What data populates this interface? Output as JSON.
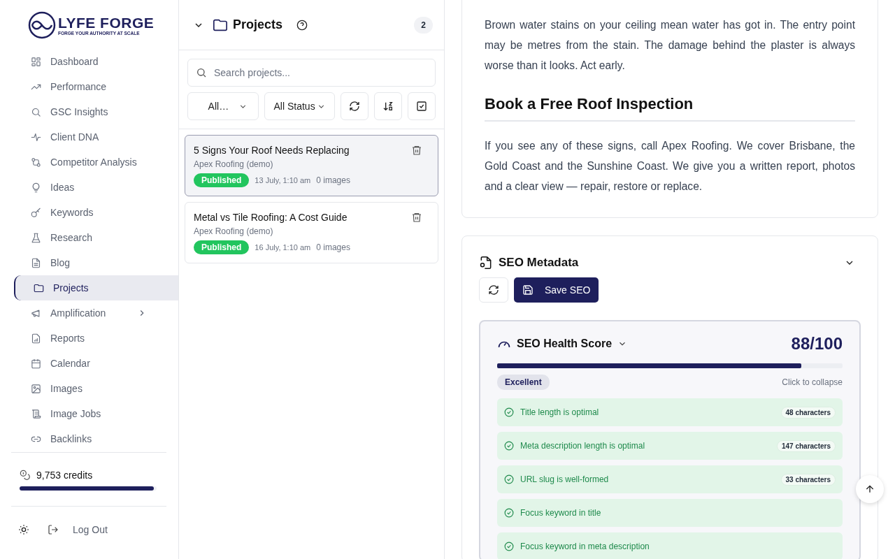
{
  "brand": {
    "name": "LYFE FORGE",
    "tagline": "FORGE YOUR AUTHORITY AT SCALE"
  },
  "sidebar": {
    "items": [
      {
        "label": "Dashboard",
        "selected": false
      },
      {
        "label": "Performance",
        "selected": false
      },
      {
        "label": "GSC Insights",
        "selected": false
      },
      {
        "label": "Client DNA",
        "selected": false
      },
      {
        "label": "Competitor Analysis",
        "selected": false
      },
      {
        "label": "Ideas",
        "selected": false
      },
      {
        "label": "Keywords",
        "selected": false
      },
      {
        "label": "Research",
        "selected": false
      },
      {
        "label": "Blog",
        "selected": false
      },
      {
        "label": "Projects",
        "selected": true
      },
      {
        "label": "Amplification",
        "selected": false,
        "expandable": true
      },
      {
        "label": "Reports",
        "selected": false
      },
      {
        "label": "Calendar",
        "selected": false
      },
      {
        "label": "Images",
        "selected": false
      },
      {
        "label": "Image Jobs",
        "selected": false
      },
      {
        "label": "Backlinks",
        "selected": false
      }
    ],
    "credits": {
      "text": "9,753 credits",
      "level": 0.98
    },
    "logout": "Log Out"
  },
  "projects": {
    "title": "Projects",
    "count": "2",
    "search": {
      "placeholder": "Search projects..."
    },
    "filters": [
      "All…",
      "All Status"
    ],
    "items": [
      {
        "title": "5 Signs Your Roof Needs Replacing",
        "client": "Apex Roofing (demo)",
        "status": "Published",
        "date": "13 July, 1:10 am",
        "images": "0 images",
        "selected": true
      },
      {
        "title": "Metal vs Tile Roofing: A Cost Guide",
        "client": "Apex Roofing (demo)",
        "status": "Published",
        "date": "16 July, 1:10 am",
        "images": "0 images",
        "selected": false
      }
    ]
  },
  "article": {
    "blocks": [
      {
        "kind": "paragraph",
        "text": "Brown water stains on your ceiling mean water has got in. The entry point may be metres from the stain. The damage behind the plaster is always worse than it looks. Act early."
      },
      {
        "kind": "heading",
        "text": "Book a Free Roof Inspection"
      },
      {
        "kind": "paragraph",
        "text": "If you see any of these signs, call Apex Roofing. We cover Brisbane, the Gold Coast and the Sunshine Coast. We give you a written report, photos and a clear view — repair, restore or replace."
      }
    ]
  },
  "seo": {
    "title": "SEO Metadata",
    "save": "Save SEO",
    "health": {
      "title": "SEO Health Score",
      "score": "88/100",
      "level": 0.88,
      "rating": "Excellent",
      "hint": "Click to collapse",
      "checks": [
        {
          "text": "Title length is optimal",
          "detail": "48 characters",
          "passed": true
        },
        {
          "text": "Meta description length is optimal",
          "detail": "147 characters",
          "passed": true
        },
        {
          "text": "URL slug is well-formed",
          "detail": "33 characters",
          "passed": true
        },
        {
          "text": "Focus keyword in title",
          "passed": true
        },
        {
          "text": "Focus keyword in meta description",
          "passed": true
        }
      ]
    }
  }
}
